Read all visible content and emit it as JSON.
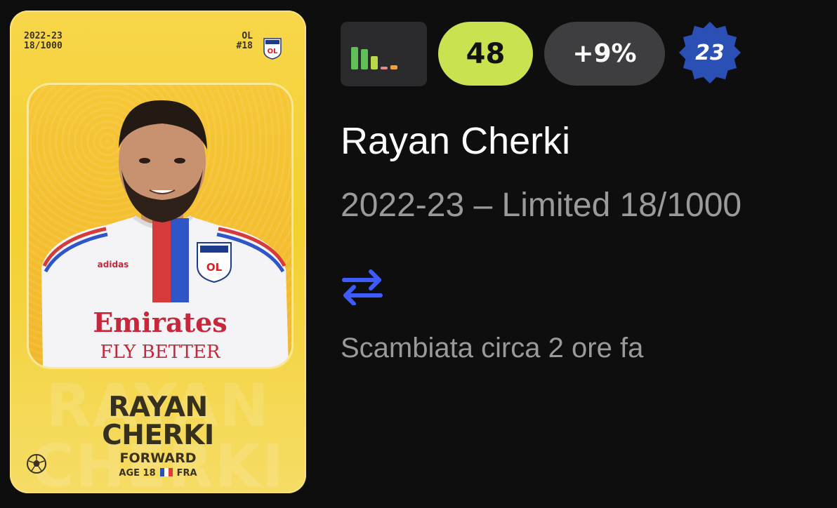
{
  "card": {
    "season": "2022-23",
    "serial": "18/1000",
    "club_code": "OL",
    "shirt_number": "#18",
    "first_name": "RAYAN",
    "last_name": "CHERKI",
    "position": "FORWARD",
    "age": "AGE 18",
    "nationality": "FRA",
    "jersey_sponsor_line1": "Emirates",
    "jersey_sponsor_line2": "FLY BETTER",
    "jersey_brand": "adidas",
    "rarity_color": "#f3cf2f",
    "icons": [
      "ol-club-badge-icon",
      "football-icon",
      "france-flag-icon"
    ]
  },
  "stats": {
    "form_bars": [
      {
        "level": 0.8,
        "color": "#5fc05a"
      },
      {
        "level": 0.72,
        "color": "#5fc05a"
      },
      {
        "level": 0.48,
        "color": "#b9d94a"
      },
      {
        "level": 0.1,
        "color": "#e58a8a"
      },
      {
        "level": 0.14,
        "color": "#f0a23a"
      }
    ],
    "score": "48",
    "score_color": "#c8e34f",
    "change": "+9%",
    "season_badge": "23",
    "season_badge_color": "#2a4fb5"
  },
  "info": {
    "player_name": "Rayan Cherki",
    "edition": "2022-23 – Limited 18/1000",
    "trade_icon": "swap-arrows-icon",
    "trade_icon_color": "#3d5cff",
    "trade_status": "Scambiata circa 2 ore fa"
  }
}
